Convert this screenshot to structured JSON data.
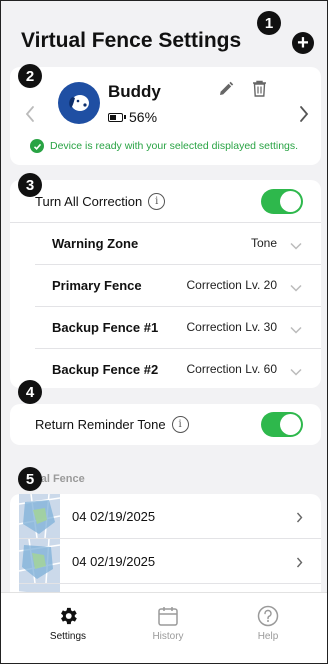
{
  "header": {
    "title": "Virtual Fence Settings",
    "add_label": "+"
  },
  "callouts": [
    "1",
    "2",
    "3",
    "4",
    "5"
  ],
  "dog": {
    "name": "Buddy",
    "battery_text": "56%",
    "battery_level": 0.56,
    "ready_text": "Device is ready with your selected displayed settings."
  },
  "correction": {
    "toggle_label": "Turn All Correction",
    "toggle_on": true,
    "rows": [
      {
        "label": "Warning Zone",
        "value": "Tone"
      },
      {
        "label": "Primary Fence",
        "value": "Correction Lv. 20"
      },
      {
        "label": "Backup Fence #1",
        "value": "Correction Lv. 30"
      },
      {
        "label": "Backup Fence #2",
        "value": "Correction Lv. 60"
      }
    ]
  },
  "return_reminder": {
    "label": "Return Reminder Tone",
    "toggle_on": true
  },
  "virtual_fence": {
    "section_label": "ual Fence",
    "items": [
      {
        "date": "04 02/19/2025"
      },
      {
        "date": "04 02/19/2025"
      },
      {
        "date": ""
      }
    ]
  },
  "tabs": [
    {
      "label": "Settings",
      "active": true
    },
    {
      "label": "History",
      "active": false
    },
    {
      "label": "Help",
      "active": false
    }
  ],
  "colors": {
    "accent_green": "#2eb84c",
    "ready_green": "#29a344",
    "avatar_blue": "#1f4fa3",
    "inactive_gray": "#9a9a9a"
  }
}
